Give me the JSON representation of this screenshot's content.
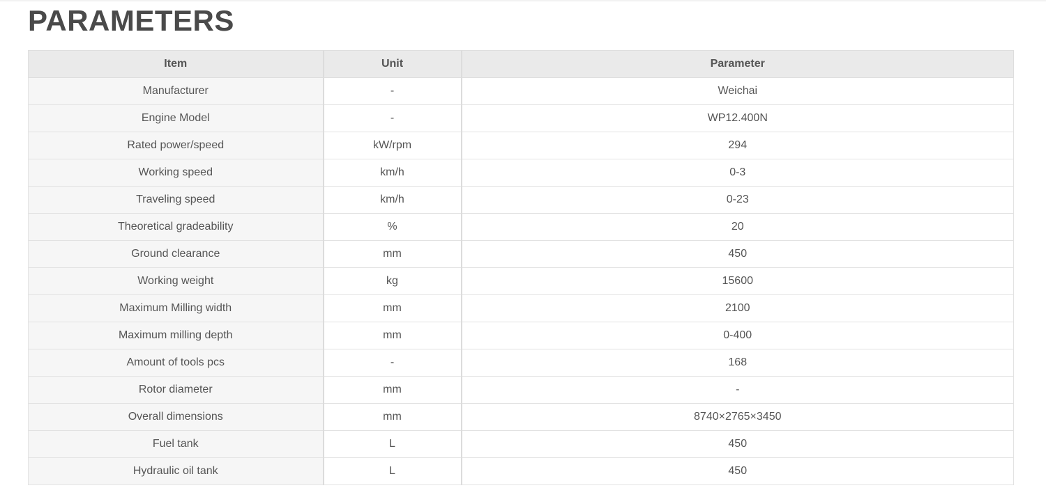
{
  "page": {
    "title": "PARAMETERS"
  },
  "table": {
    "headers": {
      "item": "Item",
      "unit": "Unit",
      "parameter": "Parameter"
    },
    "rows": [
      {
        "item": "Manufacturer",
        "unit": "-",
        "parameter": "Weichai"
      },
      {
        "item": "Engine Model",
        "unit": "-",
        "parameter": "WP12.400N"
      },
      {
        "item": "Rated power/speed",
        "unit": "kW/rpm",
        "parameter": "294"
      },
      {
        "item": "Working speed",
        "unit": "km/h",
        "parameter": "0-3"
      },
      {
        "item": "Traveling speed",
        "unit": "km/h",
        "parameter": "0-23"
      },
      {
        "item": "Theoretical gradeability",
        "unit": "%",
        "parameter": "20"
      },
      {
        "item": "Ground clearance",
        "unit": "mm",
        "parameter": "450"
      },
      {
        "item": "Working weight",
        "unit": "kg",
        "parameter": "15600"
      },
      {
        "item": "Maximum Milling width",
        "unit": "mm",
        "parameter": "2100"
      },
      {
        "item": "Maximum milling depth",
        "unit": "mm",
        "parameter": "0-400"
      },
      {
        "item": "Amount of tools pcs",
        "unit": "-",
        "parameter": "168"
      },
      {
        "item": "Rotor diameter",
        "unit": "mm",
        "parameter": "-"
      },
      {
        "item": "Overall dimensions",
        "unit": "mm",
        "parameter": "8740×2765×3450"
      },
      {
        "item": "Fuel tank",
        "unit": "L",
        "parameter": "450"
      },
      {
        "item": "Hydraulic oil tank",
        "unit": "L",
        "parameter": "450"
      }
    ]
  },
  "colors": {
    "header_bg": "#eaeaea",
    "item_col_bg": "#f6f6f6",
    "text": "#555555",
    "title": "#4a4a4a",
    "border": "#e2e2e2"
  }
}
